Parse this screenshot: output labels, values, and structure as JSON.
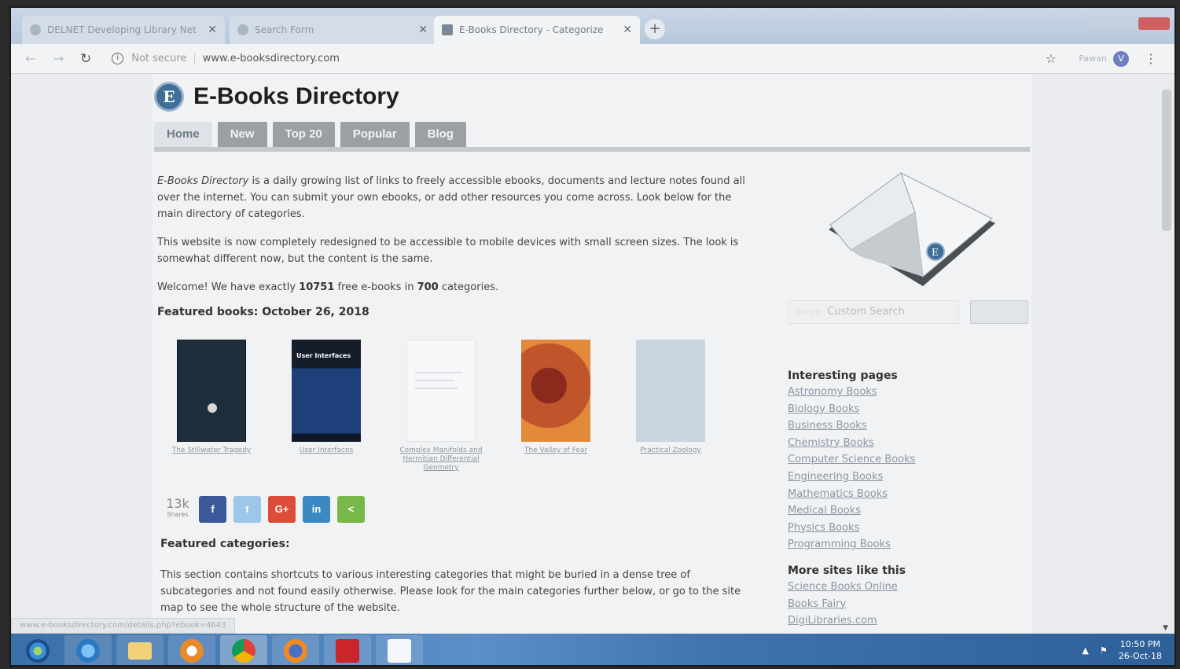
{
  "browser": {
    "tabs": [
      {
        "title": "DELNET Developing Library Net"
      },
      {
        "title": "Search Form"
      },
      {
        "title": "E-Books Directory - Categorize"
      }
    ],
    "new_tab": "+",
    "address": {
      "security": "Not secure",
      "url": "www.e-booksdirectory.com"
    },
    "profile": "Pawan",
    "profile_initial": "V"
  },
  "site": {
    "logo_letter": "E",
    "title": "E-Books Directory",
    "nav": [
      "Home",
      "New",
      "Top 20",
      "Popular",
      "Blog"
    ],
    "intro": {
      "brand": "E-Books Directory",
      "p1_rest": " is a daily growing list of links to freely accessible ebooks, documents and lecture notes found all over the internet. You can submit your own ebooks, or add other resources you come across. Look below for the main directory of categories.",
      "p2": "This website is now completely redesigned to be accessible to mobile devices with small screen sizes. The look is somewhat different now, but the content is the same.",
      "welcome_pre": "Welcome! We have exactly ",
      "books_count": "10751",
      "welcome_mid": " free e-books in ",
      "categories_count": "700",
      "welcome_post": " categories."
    },
    "featured_title": "Featured books: October 26, 2018",
    "books": [
      {
        "title": "The Stillwater Tragedy",
        "cover_color": "#1f2e3c"
      },
      {
        "title": "User Interfaces",
        "cover_color": "#1d3f7a",
        "cover_text": "User Interfaces"
      },
      {
        "title": "Complex Manifolds and Hermitian Differential Geometry",
        "cover_color": "#f7f8f9"
      },
      {
        "title": "The Valley of Fear",
        "cover_color": "#c0542a"
      },
      {
        "title": "Practical Zoology",
        "cover_color": "#c9d4e0"
      }
    ],
    "share": {
      "count": "13k",
      "label": "Shares",
      "buttons": [
        "f",
        "t",
        "G+",
        "in",
        "<"
      ]
    },
    "featured_categories_title": "Featured categories:",
    "featured_categories_text": "This section contains shortcuts to various interesting categories that might be buried in a dense tree of subcategories and not found easily otherwise. Please look for the main categories further below, or go to the site map to see the whole structure of the website.",
    "search": {
      "prefix": "Google",
      "placeholder": "Custom Search"
    },
    "sidebar": {
      "interesting_title": "Interesting pages",
      "interesting_links": [
        "Astronomy Books",
        "Biology Books",
        "Business Books",
        "Chemistry Books",
        "Computer Science Books",
        "Engineering Books",
        "Mathematics Books",
        "Medical Books",
        "Physics Books",
        "Programming Books"
      ],
      "more_title": "More sites like this",
      "more_links": [
        "Science Books Online",
        "Books Fairy",
        "DigiLibraries.com"
      ]
    }
  },
  "status_url": "www.e-booksdirectory.com/details.php?ebook=4643",
  "taskbar": {
    "time": "10:50 PM",
    "date": "26-Oct-18"
  },
  "colors": {
    "facebook": "#3b5998",
    "twitter": "#9cc7e8",
    "google": "#dd4b39",
    "linkedin": "#3b88c3",
    "share": "#78b84a"
  }
}
